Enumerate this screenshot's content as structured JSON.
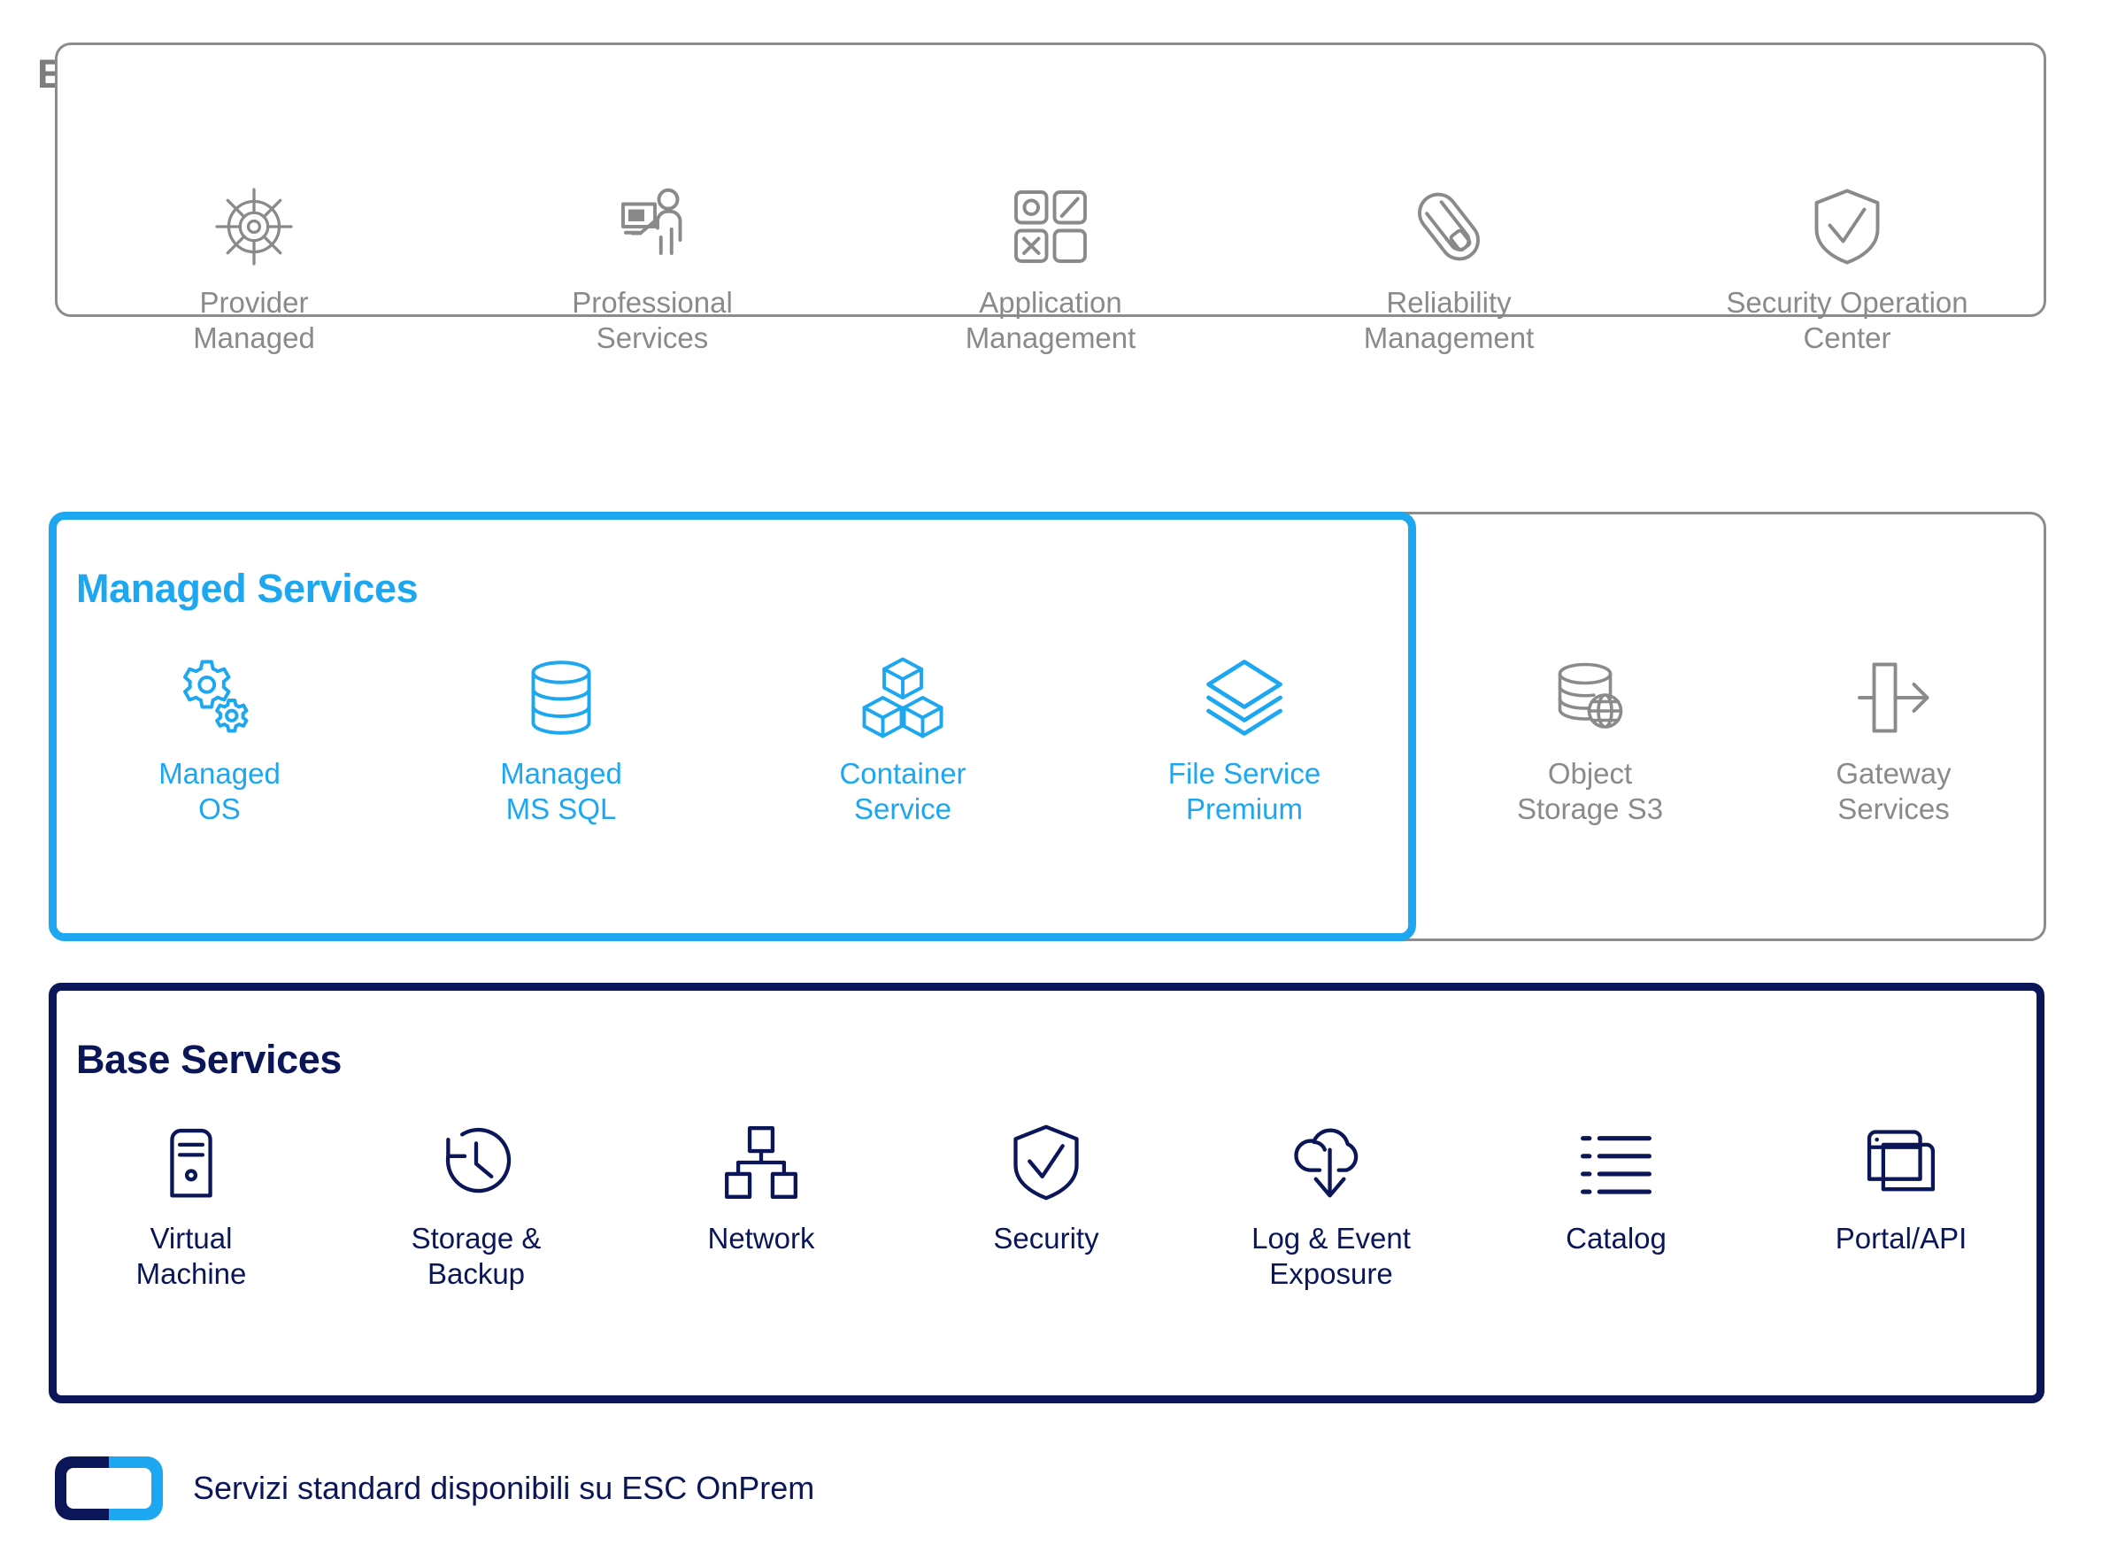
{
  "colors": {
    "gray": "#8a8a8a",
    "blue": "#1ca7f0",
    "navy": "#0b1659",
    "panel_border_gray": "#8c8c8c",
    "background": "#ffffff"
  },
  "sections": {
    "extended": {
      "title": "Extended Services",
      "items": [
        {
          "label": "Provider\nManaged",
          "icon": "ship-wheel-icon"
        },
        {
          "label": "Professional\nServices",
          "icon": "presenter-person-icon"
        },
        {
          "label": "Application\nManagement",
          "icon": "four-tiles-icon"
        },
        {
          "label": "Reliability\nManagement",
          "icon": "carabiner-icon"
        },
        {
          "label": "Security Operation\nCenter",
          "icon": "shield-check-icon"
        }
      ]
    },
    "managed": {
      "title": "Managed Services",
      "items": [
        {
          "label": "Managed\nOS",
          "icon": "gears-icon"
        },
        {
          "label": "Managed\nMS SQL",
          "icon": "database-icon"
        },
        {
          "label": "Container\nService",
          "icon": "cubes-icon"
        },
        {
          "label": "File Service\nPremium",
          "icon": "layers-icon"
        }
      ]
    },
    "storage": {
      "items": [
        {
          "label": "Object\nStorage S3",
          "icon": "database-globe-icon"
        },
        {
          "label": "Gateway\nServices",
          "icon": "gateway-arrow-icon"
        }
      ]
    },
    "base": {
      "title": "Base Services",
      "items": [
        {
          "label": "Virtual\nMachine",
          "icon": "server-tower-icon"
        },
        {
          "label": "Storage &\nBackup",
          "icon": "clock-restore-icon"
        },
        {
          "label": "Network",
          "icon": "network-tree-icon"
        },
        {
          "label": "Security",
          "icon": "shield-check-icon"
        },
        {
          "label": "Log & Event\nExposure",
          "icon": "cloud-download-icon"
        },
        {
          "label": "Catalog",
          "icon": "list-icon"
        },
        {
          "label": "Portal/API",
          "icon": "windows-icon"
        }
      ]
    }
  },
  "legend": {
    "label": "Servizi standard disponibili su ESC OnPrem",
    "swatch_left_color": "#0b1659",
    "swatch_right_color": "#1ca7f0"
  }
}
